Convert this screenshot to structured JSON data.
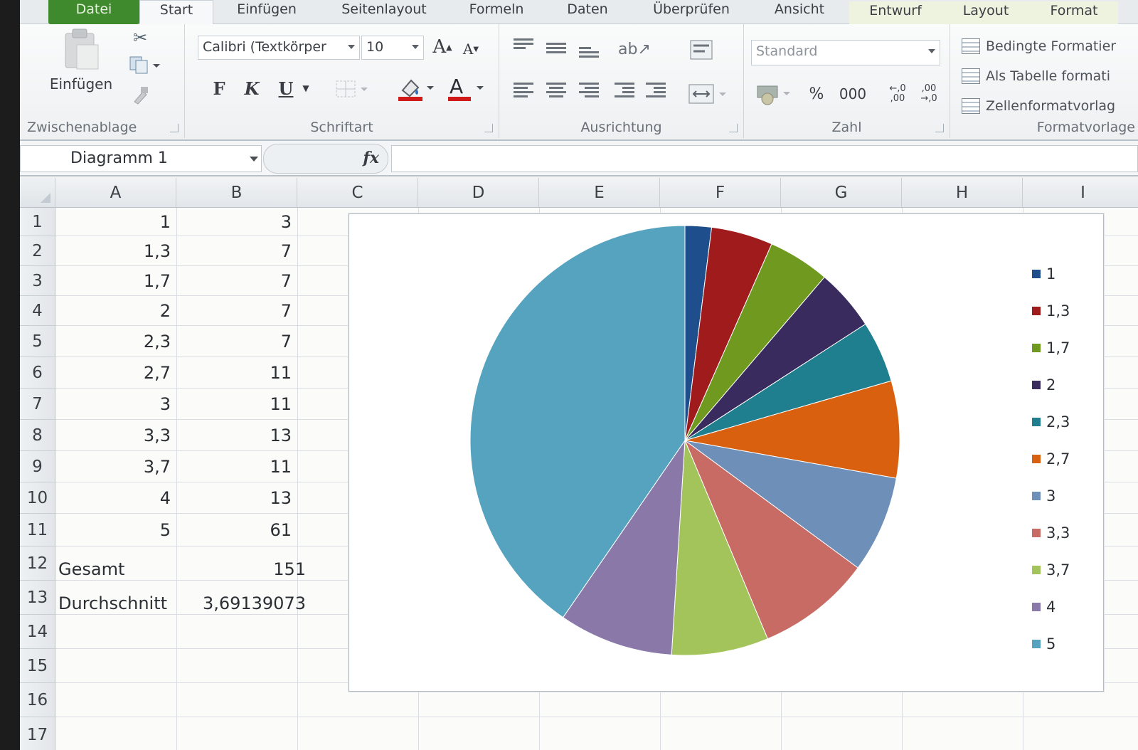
{
  "ribbon": {
    "tabs": [
      "Datei",
      "Start",
      "Einfügen",
      "Seitenlayout",
      "Formeln",
      "Daten",
      "Überprüfen",
      "Ansicht",
      "Entwurf",
      "Layout",
      "Format"
    ],
    "clipboard": {
      "paste_label": "Einfügen",
      "group_label": "Zwischenablage"
    },
    "font": {
      "name": "Calibri (Textkörper",
      "size": "10",
      "bold": "F",
      "italic": "K",
      "underline": "U",
      "group_label": "Schriftart"
    },
    "alignment": {
      "group_label": "Ausrichtung"
    },
    "number": {
      "format": "Standard",
      "percent": "%",
      "thousands": "000",
      "increase_decimal": "←,0\n,00",
      "decrease_decimal": ",00\n→,0",
      "group_label": "Zahl"
    },
    "styles": {
      "conditional": "Bedingte Formatier",
      "as_table": "Als Tabelle formati",
      "cell_styles": "Zellenformatvorlag",
      "group_label": "Formatvorlage"
    }
  },
  "formula_bar": {
    "name_box": "Diagramm 1",
    "fx": "fx"
  },
  "sheet": {
    "columns": [
      "A",
      "B",
      "C",
      "D",
      "E",
      "F",
      "G",
      "H",
      "I"
    ],
    "rows": [
      "1",
      "2",
      "3",
      "4",
      "5",
      "6",
      "7",
      "8",
      "9",
      "10",
      "11",
      "12",
      "13",
      "14",
      "15",
      "16",
      "17"
    ],
    "cells": [
      [
        "1",
        "3"
      ],
      [
        "1,3",
        "7"
      ],
      [
        "1,7",
        "7"
      ],
      [
        "2",
        "7"
      ],
      [
        "2,3",
        "7"
      ],
      [
        "2,7",
        "11"
      ],
      [
        "3",
        "11"
      ],
      [
        "3,3",
        "13"
      ],
      [
        "3,7",
        "11"
      ],
      [
        "4",
        "13"
      ],
      [
        "5",
        "61"
      ]
    ],
    "total_label": "Gesamt",
    "total_value": "151",
    "avg_label": "Durchschnitt",
    "avg_value": "3,69139073"
  },
  "chart_data": {
    "type": "pie",
    "categories": [
      "1",
      "1,3",
      "1,7",
      "2",
      "2,3",
      "2,7",
      "3",
      "3,3",
      "3,7",
      "4",
      "5"
    ],
    "values": [
      3,
      7,
      7,
      7,
      7,
      11,
      11,
      13,
      11,
      13,
      61
    ],
    "colors": [
      "#1f4e8c",
      "#a01c1c",
      "#6f9a1f",
      "#3a2b5e",
      "#1f7f8f",
      "#d9600f",
      "#6e90b8",
      "#c86b64",
      "#a3c45a",
      "#8a78a8",
      "#55a3bf"
    ],
    "legend_position": "right",
    "title": ""
  }
}
